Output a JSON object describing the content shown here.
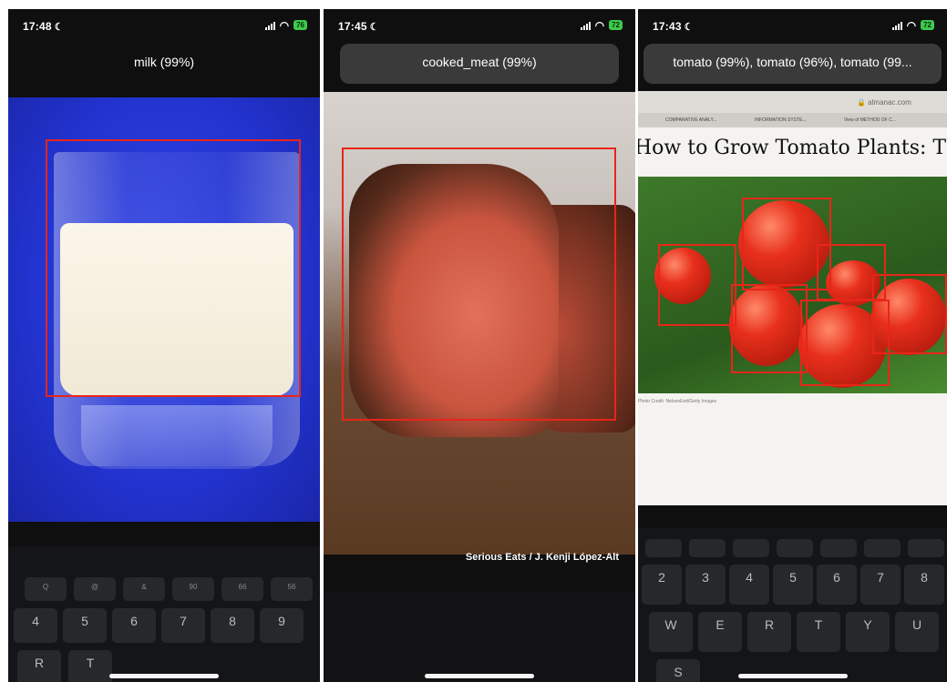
{
  "phones": [
    {
      "time": "17:48",
      "battery": "76",
      "detection_label": "milk (99%)",
      "keys_row1": [
        "Q",
        "@",
        "&",
        "90",
        "66",
        "56"
      ],
      "keys_row2": [
        "4",
        "5",
        "6",
        "7",
        "8",
        "9"
      ],
      "keys_row3": [
        "R",
        "T"
      ]
    },
    {
      "time": "17:45",
      "battery": "72",
      "detection_label": "cooked_meat (99%)",
      "credit": "Serious Eats / J. Kenji López-Alt"
    },
    {
      "time": "17:43",
      "battery": "72",
      "detection_label": "tomato (99%), tomato (96%), tomato (99...",
      "url": "🔒 almanac.com",
      "tabs": [
        "COMPARATIVE ANALY...",
        "INFORMATION SYSTE...",
        "View of METHOD OF C..."
      ],
      "headline": "How to Grow Tomato Plants: Th",
      "caption": "Photo Credit: NelsonEnd/Getty Images",
      "keys_row1": [
        "2",
        "3",
        "4",
        "5",
        "6",
        "7",
        "8"
      ],
      "keys_row2": [
        "W",
        "E",
        "R",
        "T",
        "Y",
        "U"
      ],
      "keys_row3": [
        "S"
      ]
    }
  ],
  "colors": {
    "bbox": "#e8251a",
    "battery": "#3ec94d"
  }
}
